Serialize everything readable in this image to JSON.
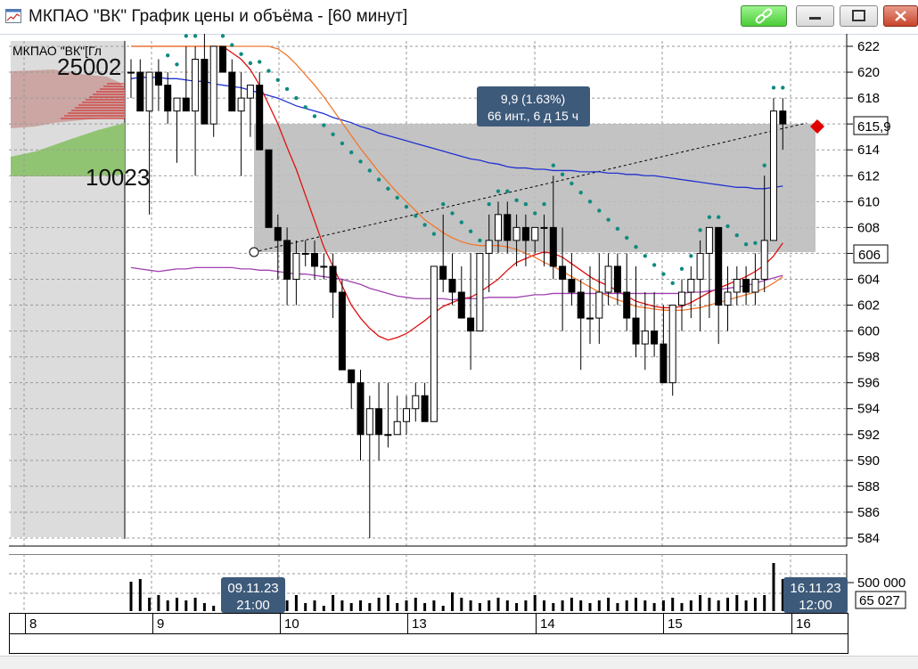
{
  "window": {
    "title": "МКПАО \"ВК\" График цены и объёма - [60 минут]",
    "icon": "chart-window-icon",
    "buttons": [
      "link-icon",
      "minimize-icon",
      "maximize-icon",
      "close-icon"
    ]
  },
  "chart_data": [
    {
      "type": "candlestick",
      "title": "МКПАО \"ВК\"[Гл",
      "ylim": [
        584,
        622
      ],
      "y_ticks": [
        "622",
        "620",
        "618",
        "616",
        "614",
        "612",
        "610",
        "608",
        "606",
        "604",
        "602",
        "600",
        "598",
        "596",
        "594",
        "592",
        "590",
        "588",
        "586",
        "584"
      ],
      "last_price_label": "615,9",
      "level_label": "606",
      "volume_profile_labels": [
        "25002",
        "10023"
      ],
      "measure_tooltip": {
        "line1": "9,9 (1.63%)",
        "line2": "66 инт., 6 д 15 ч"
      },
      "grid": true,
      "series": [
        {
          "name": "candles",
          "ohlc": [
            [
              620,
              621,
              618,
              620
            ],
            [
              620,
              621,
              617,
              617
            ],
            [
              617,
              620,
              609,
              620
            ],
            [
              620,
              621,
              617,
              619
            ],
            [
              619,
              620,
              616,
              617
            ],
            [
              617,
              618,
              613,
              618
            ],
            [
              618,
              622,
              617,
              617
            ],
            [
              617,
              622,
              612,
              621
            ],
            [
              621,
              623,
              616,
              616
            ],
            [
              616,
              622,
              615,
              622
            ],
            [
              622,
              622,
              620,
              620
            ],
            [
              620,
              621,
              617,
              617
            ],
            [
              617,
              620,
              612,
              618
            ],
            [
              618,
              619,
              615,
              619
            ],
            [
              619,
              620,
              614,
              614
            ],
            [
              614,
              614,
              608,
              608
            ],
            [
              608,
              609,
              604,
              607
            ],
            [
              607,
              608,
              602,
              604
            ],
            [
              604,
              607,
              602,
              606
            ],
            [
              606,
              607,
              605,
              606
            ],
            [
              606,
              607,
              604,
              605
            ],
            [
              605,
              606,
              604,
              605
            ],
            [
              605,
              606,
              601,
              603
            ],
            [
              603,
              604,
              597,
              597
            ],
            [
              597,
              597,
              594,
              596
            ],
            [
              596,
              597,
              590,
              592
            ],
            [
              592,
              595,
              584,
              594
            ],
            [
              594,
              596,
              590,
              592
            ],
            [
              592,
              596,
              591,
              592
            ],
            [
              592,
              595,
              592,
              593
            ],
            [
              593,
              595,
              592,
              594
            ],
            [
              594,
              596,
              593,
              595
            ],
            [
              595,
              596,
              593,
              593
            ],
            [
              593,
              605,
              598,
              605
            ],
            [
              605,
              609,
              603,
              604
            ],
            [
              604,
              606,
              602,
              603
            ],
            [
              603,
              605,
              601,
              601
            ],
            [
              601,
              606,
              597,
              600
            ],
            [
              600,
              606,
              600,
              606
            ],
            [
              606,
              609,
              603,
              607
            ],
            [
              607,
              610,
              606,
              609
            ],
            [
              609,
              610,
              606,
              607
            ],
            [
              607,
              609,
              605,
              608
            ],
            [
              608,
              609,
              605,
              607
            ],
            [
              607,
              608,
              606,
              608
            ],
            [
              608,
              609,
              605,
              608
            ],
            [
              608,
              612,
              604,
              605
            ],
            [
              605,
              608,
              600,
              604
            ],
            [
              604,
              606,
              602,
              603
            ],
            [
              603,
              604,
              597,
              601
            ],
            [
              601,
              605,
              599,
              601
            ],
            [
              601,
              606,
              599,
              603
            ],
            [
              603,
              606,
              602,
              605
            ],
            [
              605,
              606,
              602,
              603
            ],
            [
              603,
              606,
              600,
              601
            ],
            [
              601,
              605,
              598,
              599
            ],
            [
              599,
              603,
              597,
              600
            ],
            [
              600,
              603,
              598,
              599
            ],
            [
              599,
              602,
              596,
              596
            ],
            [
              596,
              602,
              595,
              602
            ],
            [
              602,
              604,
              600,
              603
            ],
            [
              603,
              605,
              601,
              604
            ],
            [
              604,
              607,
              600,
              606
            ],
            [
              606,
              608,
              601,
              608
            ],
            [
              608,
              608,
              599,
              602
            ],
            [
              602,
              605,
              600,
              603
            ],
            [
              603,
              605,
              602,
              604
            ],
            [
              604,
              605,
              602,
              603
            ],
            [
              603,
              606,
              602,
              604
            ],
            [
              604,
              612,
              603,
              607
            ],
            [
              607,
              618,
              607,
              617
            ],
            [
              617,
              618,
              614,
              616
            ]
          ]
        },
        {
          "name": "",
          "color": "#2032d0",
          "values": [
            619.5,
            619.6,
            619.6,
            619.6,
            619.5,
            619.5,
            619.4,
            619.3,
            619.3,
            619.1,
            619,
            618.9,
            618.8,
            618.6,
            618.4,
            618.2,
            618,
            617.7,
            617.4,
            617.2,
            617,
            616.8,
            616.5,
            616.3,
            616.1,
            615.8,
            615.6,
            615.3,
            615.1,
            614.9,
            614.7,
            614.5,
            614.3,
            614.1,
            613.9,
            613.7,
            613.5,
            613.3,
            613.2,
            613,
            612.9,
            612.7,
            612.6,
            612.6,
            612.5,
            612.5,
            612.4,
            612.4,
            612.4,
            612.3,
            612.3,
            612.3,
            612.2,
            612.2,
            612.1,
            612.1,
            612,
            612,
            611.9,
            611.8,
            611.7,
            611.6,
            611.5,
            611.4,
            611.3,
            611.2,
            611.1,
            611.1,
            611,
            611,
            611.1,
            611.2
          ]
        },
        {
          "name": "",
          "color": "#e01010",
          "values": [
            622,
            622,
            622,
            622,
            622,
            622,
            622,
            622,
            622,
            622,
            622,
            621.5,
            621,
            620.2,
            619,
            617.5,
            616,
            614.2,
            612.5,
            610.5,
            608.5,
            606.5,
            605,
            603.5,
            602,
            601,
            600.2,
            599.6,
            599.3,
            599.5,
            599.8,
            600.3,
            600.8,
            601.4,
            601.9,
            602.2,
            602.5,
            602.6,
            603,
            603.5,
            604,
            604.7,
            605.3,
            605.6,
            605.9,
            606.1,
            606,
            605.7,
            605.2,
            604.7,
            604.2,
            603.8,
            603.5,
            603.1,
            602.7,
            602.3,
            602.1,
            601.9,
            601.8,
            601.8,
            601.9,
            602.2,
            602.6,
            603,
            603.3,
            603.6,
            603.9,
            604.2,
            604.6,
            605.1,
            605.8,
            606.8
          ]
        },
        {
          "name": "",
          "color": "#f07830",
          "values": [
            622,
            622,
            622,
            622,
            622,
            622,
            622,
            622,
            622,
            622,
            622,
            622,
            622,
            622,
            622,
            622,
            621.8,
            621.3,
            620.6,
            619.8,
            619,
            618.1,
            617.1,
            616.1,
            615.1,
            614.1,
            613.2,
            612.3,
            611.5,
            610.7,
            610,
            609.3,
            608.6,
            608.1,
            607.6,
            607.2,
            606.9,
            606.7,
            606.6,
            606.6,
            606.6,
            606.5,
            606.3,
            606,
            605.7,
            605.3,
            605,
            604.6,
            604.2,
            603.8,
            603.4,
            603,
            602.7,
            602.4,
            602.2,
            601.9,
            601.8,
            601.7,
            601.6,
            601.6,
            601.6,
            601.7,
            601.8,
            602,
            602.2,
            602.4,
            602.6,
            602.8,
            603,
            603.3,
            603.7,
            604.2
          ]
        },
        {
          "name": "",
          "color": "#a040b0",
          "values": [
            604.9,
            604.8,
            604.7,
            604.6,
            604.7,
            604.8,
            604.8,
            604.9,
            604.9,
            604.9,
            604.9,
            604.9,
            604.8,
            604.8,
            604.7,
            604.7,
            604.6,
            604.5,
            604.4,
            604.4,
            604.3,
            604.2,
            604.1,
            604,
            603.8,
            603.6,
            603.3,
            603.1,
            602.9,
            602.7,
            602.6,
            602.5,
            602.5,
            602.5,
            602.5,
            602.4,
            602.5,
            602.5,
            602.5,
            602.6,
            602.6,
            602.6,
            602.6,
            602.7,
            602.8,
            602.8,
            602.9,
            602.9,
            602.9,
            602.9,
            602.9,
            602.9,
            602.9,
            602.9,
            602.9,
            602.9,
            602.9,
            602.9,
            602.9,
            602.9,
            602.9,
            603,
            603,
            603.1,
            603.2,
            603.3,
            603.4,
            603.5,
            603.7,
            603.9,
            604.1,
            604.3
          ]
        }
      ],
      "date_labels": [
        "8",
        "9",
        "10",
        "13",
        "14",
        "15",
        "16"
      ]
    },
    {
      "type": "bar",
      "title": "",
      "y_ticks": [
        "500 000"
      ],
      "last_value_label": "65 027",
      "cursor_labels": [
        {
          "date": "09.11.23",
          "time": "21:00"
        },
        {
          "date": "16.11.23",
          "time": "12:00"
        }
      ],
      "values": [
        55,
        60,
        25,
        30,
        20,
        25,
        20,
        25,
        15,
        10,
        35,
        30,
        25,
        15,
        20,
        25,
        20,
        20,
        30,
        15,
        20,
        10,
        30,
        20,
        15,
        20,
        15,
        25,
        30,
        15,
        20,
        25,
        15,
        20,
        10,
        35,
        25,
        20,
        15,
        20,
        25,
        20,
        15,
        20,
        30,
        20,
        15,
        20,
        25,
        20,
        15,
        20,
        25,
        15,
        20,
        25,
        20,
        15,
        20,
        25,
        15,
        20,
        30,
        25,
        20,
        25,
        30,
        20,
        25,
        30,
        90,
        60
      ]
    }
  ]
}
